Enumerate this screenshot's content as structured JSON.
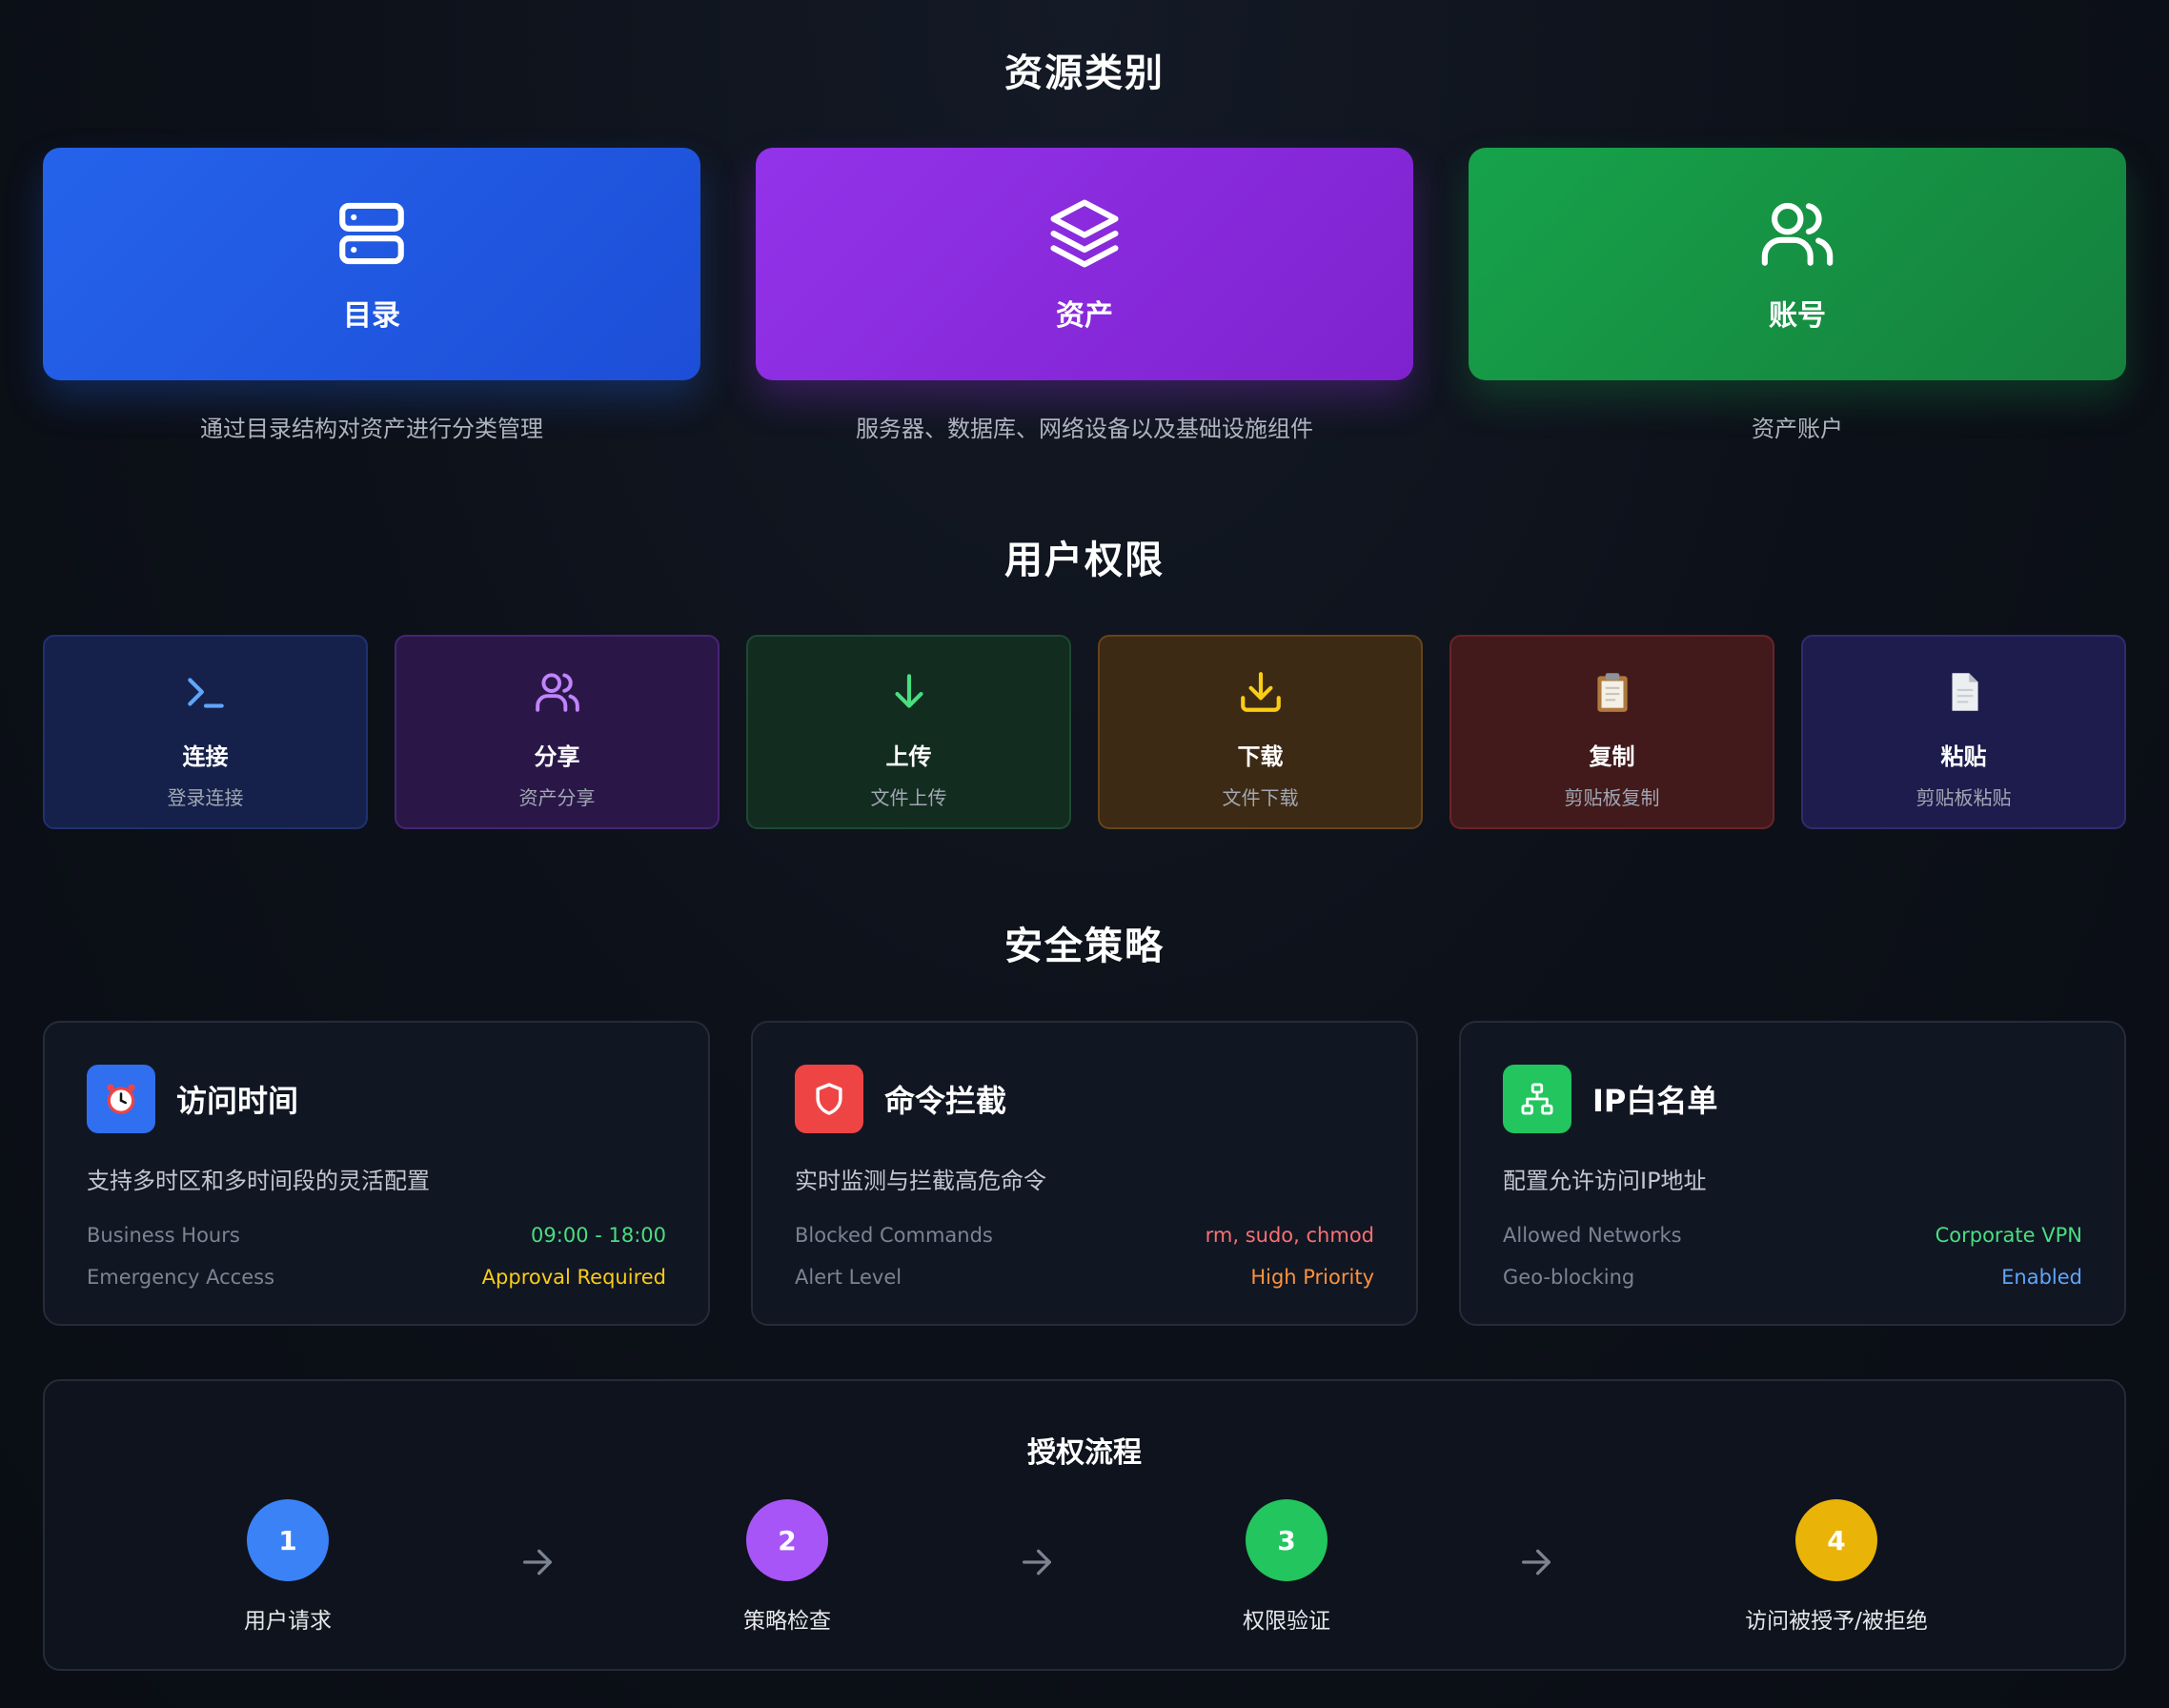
{
  "sections": {
    "resources_title": "资源类别",
    "permissions_title": "用户权限",
    "security_title": "安全策略"
  },
  "resources": [
    {
      "label": "目录",
      "desc": "通过目录结构对资产进行分类管理",
      "icon": "server-stack-icon",
      "color": "#2563eb"
    },
    {
      "label": "资产",
      "desc": "服务器、数据库、网络设备以及基础设施组件",
      "icon": "layers-icon",
      "color": "#9333ea"
    },
    {
      "label": "账号",
      "desc": "资产账户",
      "icon": "users-icon",
      "color": "#16a34a"
    }
  ],
  "permissions": [
    {
      "title": "连接",
      "sub": "登录连接",
      "icon": "terminal-icon",
      "color": "#60a5fa"
    },
    {
      "title": "分享",
      "sub": "资产分享",
      "icon": "users-icon",
      "color": "#c084fc"
    },
    {
      "title": "上传",
      "sub": "文件上传",
      "icon": "arrow-down-icon",
      "color": "#4ade80"
    },
    {
      "title": "下载",
      "sub": "文件下载",
      "icon": "download-icon",
      "color": "#facc15"
    },
    {
      "title": "复制",
      "sub": "剪贴板复制",
      "icon": "clipboard-icon",
      "color": "#f87171"
    },
    {
      "title": "粘贴",
      "sub": "剪贴板粘贴",
      "icon": "document-icon",
      "color": "#a5b4fc"
    }
  ],
  "policies": [
    {
      "title": "访问时间",
      "desc": "支持多时区和多时间段的灵活配置",
      "icon": "alarm-clock-icon",
      "rows": [
        {
          "key": "Business Hours",
          "value": "09:00 - 18:00",
          "color": "#4ade80"
        },
        {
          "key": "Emergency Access",
          "value": "Approval Required",
          "color": "#facc15"
        }
      ]
    },
    {
      "title": "命令拦截",
      "desc": "实时监测与拦截高危命令",
      "icon": "shield-icon",
      "rows": [
        {
          "key": "Blocked Commands",
          "value": "rm, sudo, chmod",
          "color": "#f87171"
        },
        {
          "key": "Alert Level",
          "value": "High Priority",
          "color": "#fb923c"
        }
      ]
    },
    {
      "title": "IP白名单",
      "desc": "配置允许访问IP地址",
      "icon": "network-icon",
      "rows": [
        {
          "key": "Allowed Networks",
          "value": "Corporate VPN",
          "color": "#4ade80"
        },
        {
          "key": "Geo-blocking",
          "value": "Enabled",
          "color": "#60a5fa"
        }
      ]
    }
  ],
  "flow": {
    "title": "授权流程",
    "steps": [
      {
        "num": "1",
        "label": "用户请求",
        "color": "#3b82f6"
      },
      {
        "num": "2",
        "label": "策略检查",
        "color": "#a855f7"
      },
      {
        "num": "3",
        "label": "权限验证",
        "color": "#22c55e"
      },
      {
        "num": "4",
        "label": "访问被授予/被拒绝",
        "color": "#eab308"
      }
    ],
    "arrow_icon": "arrow-right-icon"
  }
}
